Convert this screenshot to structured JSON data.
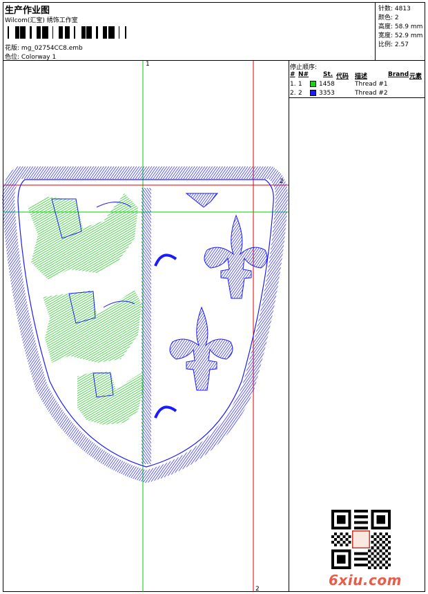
{
  "header": {
    "title": "生产作业图",
    "company": "Wilcom(汇宝) 绣饰工作室",
    "design_label": "花版:",
    "design_value": "mg_02754CC8.emb",
    "colorway_label": "色位:",
    "colorway_value": "Colorway 1"
  },
  "stats": [
    {
      "label": "针数:",
      "value": "4813"
    },
    {
      "label": "颜色:",
      "value": "2"
    },
    {
      "label": "高度:",
      "value": "58.9 mm"
    },
    {
      "label": "宽度:",
      "value": "52.9 mm"
    },
    {
      "label": "比例:",
      "value": "2.57"
    }
  ],
  "thread_panel": {
    "title": "停止顺序:",
    "headers": {
      "num": "#",
      "n": "N#",
      "st": "St.",
      "code": "代码",
      "desc": "描述",
      "brand": "Brand",
      "elem": "元素"
    },
    "rows": [
      {
        "num": "1.",
        "n": "1",
        "code": "1458",
        "desc": "Thread #1",
        "color": "#22cc22"
      },
      {
        "num": "2.",
        "n": "2",
        "code": "3353",
        "desc": "Thread #2",
        "color": "#1a1aff"
      }
    ]
  },
  "axes": {
    "top_label": "1",
    "right_label": "2",
    "bottom_label": "2"
  },
  "watermark": "6xiu.com",
  "colors": {
    "green": "#22cc22",
    "blue": "#1a1aff",
    "guide_red": "#e00000",
    "guide_green": "#00cc00"
  }
}
